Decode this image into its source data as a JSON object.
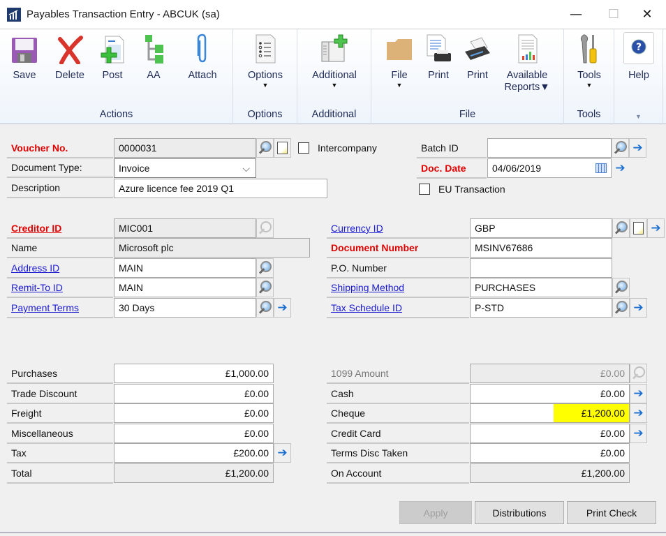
{
  "window": {
    "title": "Payables Transaction Entry  -  ABCUK (sa)",
    "icon": "gp-app-icon",
    "controls": {
      "minimize": "—",
      "maximize": "☐",
      "close": "✕"
    }
  },
  "ribbon": {
    "groups": [
      {
        "label": "Actions",
        "buttons": [
          {
            "label": "Save",
            "icon": "save-icon"
          },
          {
            "label": "Delete",
            "icon": "delete-icon"
          },
          {
            "label": "Post",
            "icon": "post-icon"
          },
          {
            "label": "AA",
            "icon": "aa-icon"
          },
          {
            "label": "Attach",
            "icon": "paperclip-icon"
          }
        ]
      },
      {
        "label": "Options",
        "buttons": [
          {
            "label": "Options",
            "icon": "options-list-icon",
            "dropdown": "▼"
          }
        ]
      },
      {
        "label": "Additional",
        "buttons": [
          {
            "label": "Additional",
            "icon": "additional-window-icon",
            "dropdown": "▼"
          }
        ]
      },
      {
        "label": "File",
        "buttons": [
          {
            "label": "File",
            "icon": "folder-icon",
            "dropdown": "▼"
          },
          {
            "label": "Print",
            "icon": "print-document-icon"
          },
          {
            "label": "Print",
            "icon": "printer-icon"
          },
          {
            "label": "Available",
            "label2": "Reports▼",
            "icon": "reports-icon"
          }
        ]
      },
      {
        "label": "Tools",
        "buttons": [
          {
            "label": "Tools",
            "icon": "tools-icon",
            "dropdown": "▼"
          }
        ]
      },
      {
        "label": "▼",
        "buttons": [
          {
            "label": "Help",
            "icon": "help-icon"
          }
        ]
      }
    ]
  },
  "header": {
    "voucher_no": {
      "label": "Voucher No.",
      "value": "0000031"
    },
    "intercompany": {
      "label": "Intercompany",
      "checked": false
    },
    "batch_id": {
      "label": "Batch ID",
      "value": ""
    },
    "document_type": {
      "label": "Document Type:",
      "value": "Invoice",
      "dropdown": "⌵"
    },
    "doc_date": {
      "label": "Doc. Date",
      "value": "04/06/2019"
    },
    "description": {
      "label": "Description",
      "value": "Azure licence fee 2019 Q1"
    },
    "eu_transaction": {
      "label": "EU Transaction",
      "checked": false
    }
  },
  "creditor": {
    "creditor_id": {
      "label": "Creditor ID",
      "value": "MIC001"
    },
    "name": {
      "label": "Name",
      "value": "Microsoft plc"
    },
    "address_id": {
      "label": "Address ID",
      "value": "MAIN"
    },
    "remit_to_id": {
      "label": "Remit-To ID",
      "value": "MAIN"
    },
    "payment_terms": {
      "label": "Payment Terms",
      "value": "30 Days"
    }
  },
  "document": {
    "currency_id": {
      "label": "Currency ID",
      "value": "GBP"
    },
    "document_number": {
      "label": "Document Number",
      "value": "MSINV67686"
    },
    "po_number": {
      "label": "P.O. Number",
      "value": ""
    },
    "shipping_method": {
      "label": "Shipping Method",
      "value": "PURCHASES"
    },
    "tax_schedule_id": {
      "label": "Tax Schedule ID",
      "value": "P-STD"
    }
  },
  "amounts_left": [
    {
      "label": "Purchases",
      "value": "£1,000.00"
    },
    {
      "label": "Trade Discount",
      "value": "£0.00"
    },
    {
      "label": "Freight",
      "value": "£0.00"
    },
    {
      "label": "Miscellaneous",
      "value": "£0.00"
    },
    {
      "label": "Tax",
      "value": "£200.00"
    },
    {
      "label": "Total",
      "value": "£1,200.00"
    }
  ],
  "amounts_right": [
    {
      "label": "1099 Amount",
      "value": "£0.00"
    },
    {
      "label": "Cash",
      "value": "£0.00"
    },
    {
      "label": "Cheque",
      "value": "£1,200.00"
    },
    {
      "label": "Credit Card",
      "value": "£0.00"
    },
    {
      "label": "Terms Disc Taken",
      "value": "£0.00"
    },
    {
      "label": "On Account",
      "value": "£1,200.00"
    }
  ],
  "buttons": {
    "apply": "Apply",
    "distributions": "Distributions",
    "print_check": "Print Check"
  },
  "colors": {
    "required_label": "#e00000",
    "link_label": "#1a1ad0",
    "highlight": "#ffff00",
    "ribbon_text": "#1e2a55"
  }
}
